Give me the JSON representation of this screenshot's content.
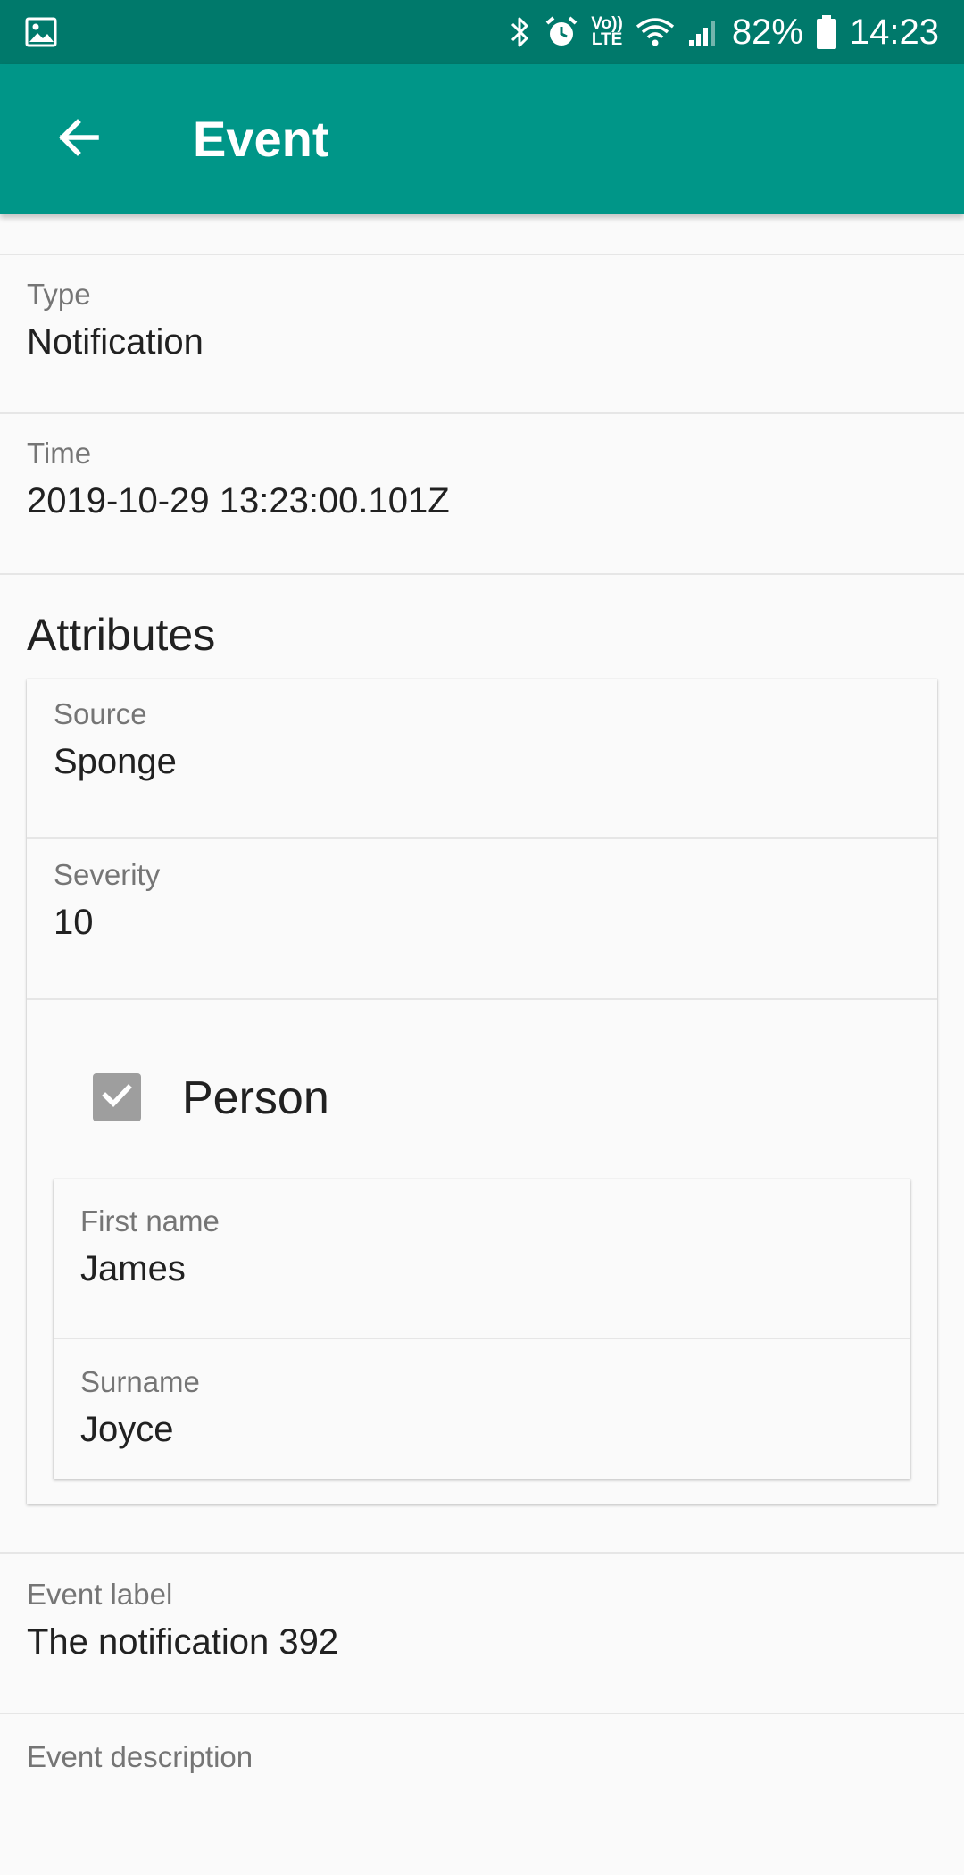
{
  "status_bar": {
    "battery": "82%",
    "time": "14:23",
    "lte_label": "LTE",
    "volte_label": "Vo))",
    "icons": [
      "image-icon",
      "bluetooth-icon",
      "alarm-icon",
      "volte-lte-icon",
      "wifi-icon",
      "signal-icon",
      "battery-icon"
    ]
  },
  "app_bar": {
    "title": "Event",
    "back_icon": "arrow-back-icon",
    "color": "#009688",
    "status_color": "#00796b"
  },
  "fields": {
    "type": {
      "label": "Type",
      "value": "Notification"
    },
    "time": {
      "label": "Time",
      "value": "2019-10-29 13:23:00.101Z"
    }
  },
  "attributes": {
    "title": "Attributes",
    "source": {
      "label": "Source",
      "value": "Sponge"
    },
    "severity": {
      "label": "Severity",
      "value": "10"
    },
    "person": {
      "label": "Person",
      "checked": true,
      "first_name": {
        "label": "First name",
        "value": "James"
      },
      "surname": {
        "label": "Surname",
        "value": "Joyce"
      }
    }
  },
  "event_label": {
    "label": "Event label",
    "value": "The notification 392"
  },
  "event_description": {
    "label": "Event description"
  }
}
